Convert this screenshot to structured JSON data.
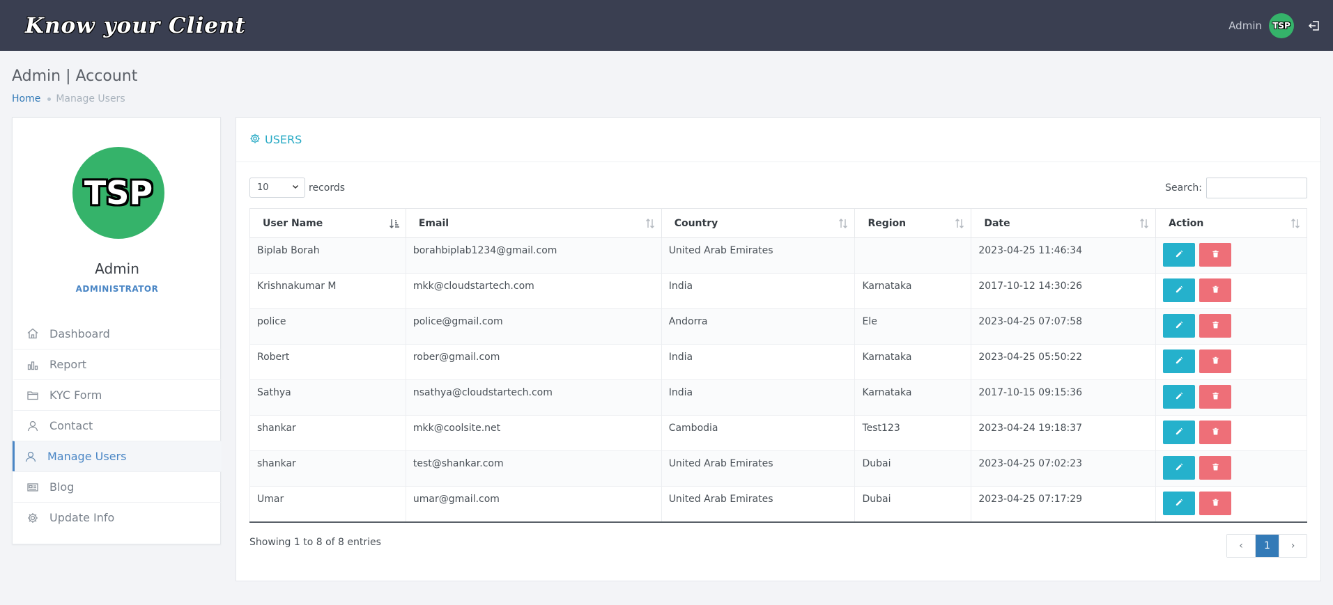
{
  "header": {
    "brand": "Know your Client",
    "user_label": "Admin",
    "avatar_text": "TSP"
  },
  "page": {
    "title": "Admin | Account",
    "breadcrumb": {
      "home": "Home",
      "current": "Manage Users"
    }
  },
  "profile": {
    "avatar_text": "TSP",
    "name": "Admin",
    "role": "ADMINISTRATOR"
  },
  "sidebar": {
    "items": [
      {
        "label": "Dashboard",
        "icon": "home-icon"
      },
      {
        "label": "Report",
        "icon": "bar-chart-icon"
      },
      {
        "label": "KYC Form",
        "icon": "folder-icon"
      },
      {
        "label": "Contact",
        "icon": "user-icon"
      },
      {
        "label": "Manage Users",
        "icon": "user-icon",
        "active": true
      },
      {
        "label": "Blog",
        "icon": "newspaper-icon"
      },
      {
        "label": "Update Info",
        "icon": "gear-icon"
      }
    ]
  },
  "card": {
    "title": "USERS",
    "length_value": "10",
    "length_suffix": "records",
    "search_label": "Search:",
    "search_value": ""
  },
  "table": {
    "columns": [
      "User Name",
      "Email",
      "Country",
      "Region",
      "Date",
      "Action"
    ],
    "rows": [
      {
        "name": "Biplab Borah",
        "email": "borahbiplab1234@gmail.com",
        "country": "United Arab Emirates",
        "region": "",
        "date": "2023-04-25 11:46:34"
      },
      {
        "name": "Krishnakumar M",
        "email": "mkk@cloudstartech.com",
        "country": "India",
        "region": "Karnataka",
        "date": "2017-10-12 14:30:26"
      },
      {
        "name": "police",
        "email": "police@gmail.com",
        "country": "Andorra",
        "region": "Ele",
        "date": "2023-04-25 07:07:58"
      },
      {
        "name": "Robert",
        "email": "rober@gmail.com",
        "country": "India",
        "region": "Karnataka",
        "date": "2023-04-25 05:50:22"
      },
      {
        "name": "Sathya",
        "email": "nsathya@cloudstartech.com",
        "country": "India",
        "region": "Karnataka",
        "date": "2017-10-15 09:15:36"
      },
      {
        "name": "shankar",
        "email": "mkk@coolsite.net",
        "country": "Cambodia",
        "region": "Test123",
        "date": "2023-04-24 19:18:37"
      },
      {
        "name": "shankar",
        "email": "test@shankar.com",
        "country": "United Arab Emirates",
        "region": "Dubai",
        "date": "2023-04-25 07:02:23"
      },
      {
        "name": "Umar",
        "email": "umar@gmail.com",
        "country": "United Arab Emirates",
        "region": "Dubai",
        "date": "2023-04-25 07:17:29"
      }
    ]
  },
  "footer": {
    "info": "Showing 1 to 8 of 8 entries",
    "prev": "‹",
    "page": "1",
    "next": "›"
  },
  "colors": {
    "header_bg": "#3a3f51",
    "accent": "#337ab7",
    "edit": "#25b1cc",
    "delete": "#ee6f78",
    "avatar": "#35b36a"
  }
}
